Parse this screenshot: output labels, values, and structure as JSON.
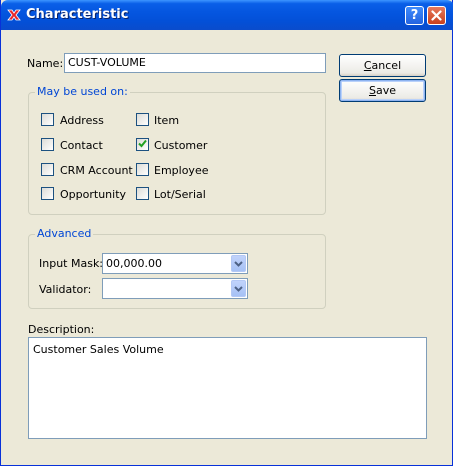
{
  "window": {
    "title": "Characteristic"
  },
  "titlebar": {
    "help_glyph": "?",
    "close_glyph": "✕"
  },
  "form": {
    "name_label": "Name:",
    "name_value": "CUST-VOLUME",
    "cancel_label": "Cancel",
    "save_label": "Save",
    "used_on": {
      "title": "May be used on:",
      "items": [
        {
          "label": "Address",
          "checked": false
        },
        {
          "label": "Item",
          "checked": false
        },
        {
          "label": "Contact",
          "checked": false
        },
        {
          "label": "Customer",
          "checked": true
        },
        {
          "label": "CRM Account",
          "checked": false
        },
        {
          "label": "Employee",
          "checked": false
        },
        {
          "label": "Opportunity",
          "checked": false
        },
        {
          "label": "Lot/Serial",
          "checked": false
        }
      ]
    },
    "advanced": {
      "title": "Advanced",
      "input_mask_label": "Input Mask:",
      "input_mask_value": "00,000.00",
      "validator_label": "Validator:",
      "validator_value": ""
    },
    "description_label": "Description:",
    "description_value": "Customer Sales Volume"
  },
  "colors": {
    "accent": "#0046d5",
    "titlebar": "#0556e0",
    "checkmark": "#21a121"
  }
}
